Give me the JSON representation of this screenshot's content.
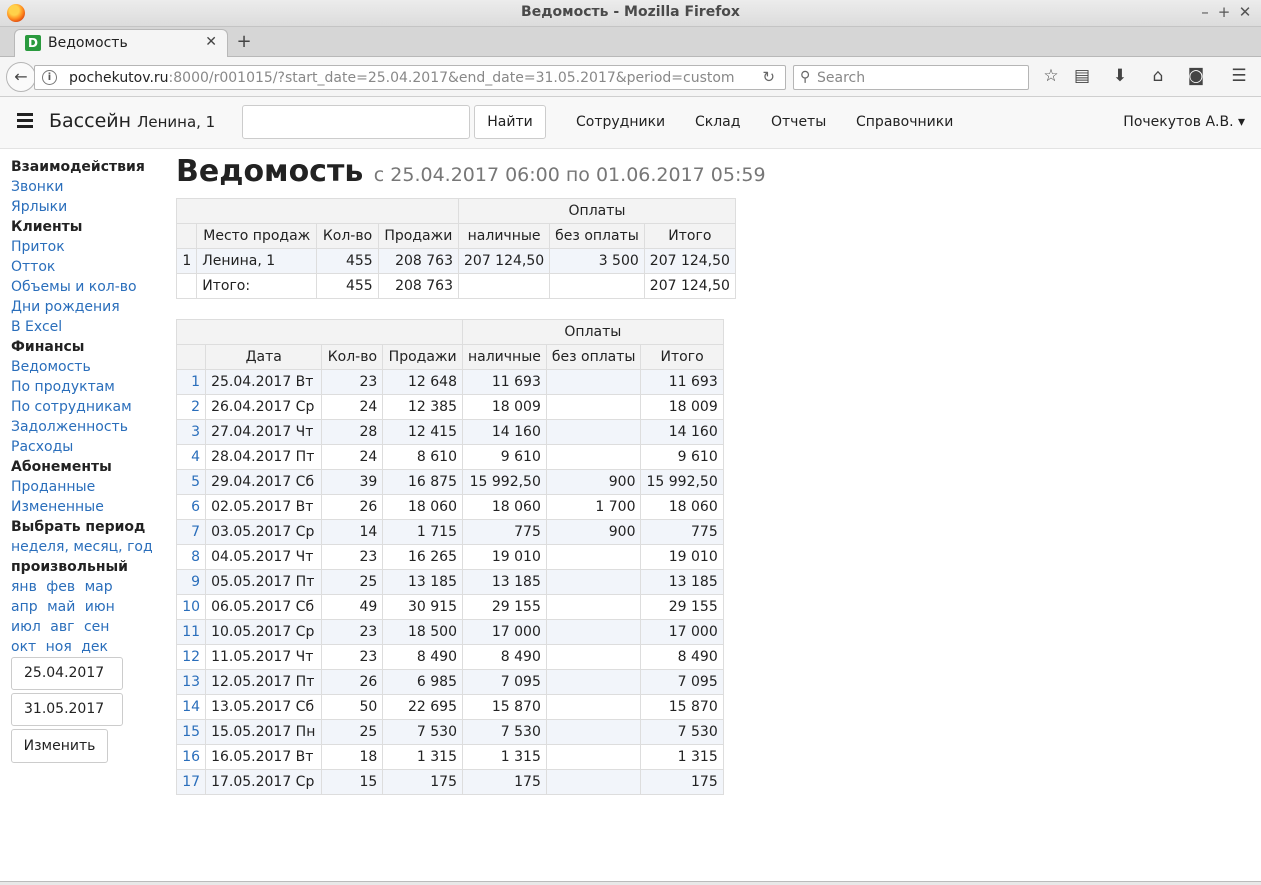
{
  "window": {
    "title": "Ведомость - Mozilla Firefox"
  },
  "tab": {
    "favicon_letter": "D",
    "label": "Ведомость"
  },
  "url": {
    "host": "pochekutov.ru",
    "rest": ":8000/r001015/?start_date=25.04.2017&end_date=31.05.2017&period=custom"
  },
  "search_placeholder": "Search",
  "header": {
    "brand": "Бассейн",
    "brand_sub": "Ленина, 1",
    "find_button": "Найти",
    "nav": [
      "Сотрудники",
      "Склад",
      "Отчеты",
      "Справочники"
    ],
    "user": "Почекутов А.В. ▾"
  },
  "sidebar": {
    "sections": [
      {
        "heading": "Взаимодействия",
        "links": [
          "Звонки",
          "Ярлыки"
        ]
      },
      {
        "heading": "Клиенты",
        "links": [
          "Приток",
          "Отток",
          "Объемы и кол-во",
          "Дни рождения",
          "В Excel"
        ]
      },
      {
        "heading": "Финансы",
        "links": [
          "Ведомость",
          "По продуктам",
          "По сотрудникам",
          "Задолженность",
          "Расходы"
        ]
      },
      {
        "heading": "Абонементы",
        "links": [
          "Проданные",
          "Измененные"
        ]
      }
    ],
    "period_heading": "Выбрать период",
    "period_links": [
      "неделя",
      "месяц",
      "год"
    ],
    "custom_heading": "произвольный",
    "months": [
      [
        "янв",
        "фев",
        "мар"
      ],
      [
        "апр",
        "май",
        "июн"
      ],
      [
        "июл",
        "авг",
        "сен"
      ],
      [
        "окт",
        "ноя",
        "дек"
      ]
    ],
    "start_date": "25.04.2017",
    "end_date": "31.05.2017",
    "change_button": "Изменить"
  },
  "page": {
    "title": "Ведомость",
    "subtitle": "с 25.04.2017 06:00 по 01.06.2017 05:59"
  },
  "summary_table": {
    "group_header": "Оплаты",
    "columns": [
      "Место продаж",
      "Кол-во",
      "Продажи",
      "наличные",
      "без оплаты",
      "Итого"
    ],
    "rows": [
      [
        "1",
        "Ленина, 1",
        "455",
        "208 763",
        "207 124,50",
        "3 500",
        "207 124,50"
      ],
      [
        "",
        "Итого:",
        "455",
        "208 763",
        "",
        "",
        "207 124,50"
      ]
    ]
  },
  "daily_table": {
    "group_header": "Оплаты",
    "columns": [
      "Дата",
      "Кол-во",
      "Продажи",
      "наличные",
      "без оплаты",
      "Итого"
    ],
    "rows": [
      [
        "1",
        "25.04.2017 Вт",
        "23",
        "12 648",
        "11 693",
        "",
        "11 693"
      ],
      [
        "2",
        "26.04.2017 Ср",
        "24",
        "12 385",
        "18 009",
        "",
        "18 009"
      ],
      [
        "3",
        "27.04.2017 Чт",
        "28",
        "12 415",
        "14 160",
        "",
        "14 160"
      ],
      [
        "4",
        "28.04.2017 Пт",
        "24",
        "8 610",
        "9 610",
        "",
        "9 610"
      ],
      [
        "5",
        "29.04.2017 Сб",
        "39",
        "16 875",
        "15 992,50",
        "900",
        "15 992,50"
      ],
      [
        "6",
        "02.05.2017 Вт",
        "26",
        "18 060",
        "18 060",
        "1 700",
        "18 060"
      ],
      [
        "7",
        "03.05.2017 Ср",
        "14",
        "1 715",
        "775",
        "900",
        "775"
      ],
      [
        "8",
        "04.05.2017 Чт",
        "23",
        "16 265",
        "19 010",
        "",
        "19 010"
      ],
      [
        "9",
        "05.05.2017 Пт",
        "25",
        "13 185",
        "13 185",
        "",
        "13 185"
      ],
      [
        "10",
        "06.05.2017 Сб",
        "49",
        "30 915",
        "29 155",
        "",
        "29 155"
      ],
      [
        "11",
        "10.05.2017 Ср",
        "23",
        "18 500",
        "17 000",
        "",
        "17 000"
      ],
      [
        "12",
        "11.05.2017 Чт",
        "23",
        "8 490",
        "8 490",
        "",
        "8 490"
      ],
      [
        "13",
        "12.05.2017 Пт",
        "26",
        "6 985",
        "7 095",
        "",
        "7 095"
      ],
      [
        "14",
        "13.05.2017 Сб",
        "50",
        "22 695",
        "15 870",
        "",
        "15 870"
      ],
      [
        "15",
        "15.05.2017 Пн",
        "25",
        "7 530",
        "7 530",
        "",
        "7 530"
      ],
      [
        "16",
        "16.05.2017 Вт",
        "18",
        "1 315",
        "1 315",
        "",
        "1 315"
      ],
      [
        "17",
        "17.05.2017 Ср",
        "15",
        "175",
        "175",
        "",
        "175"
      ]
    ]
  }
}
